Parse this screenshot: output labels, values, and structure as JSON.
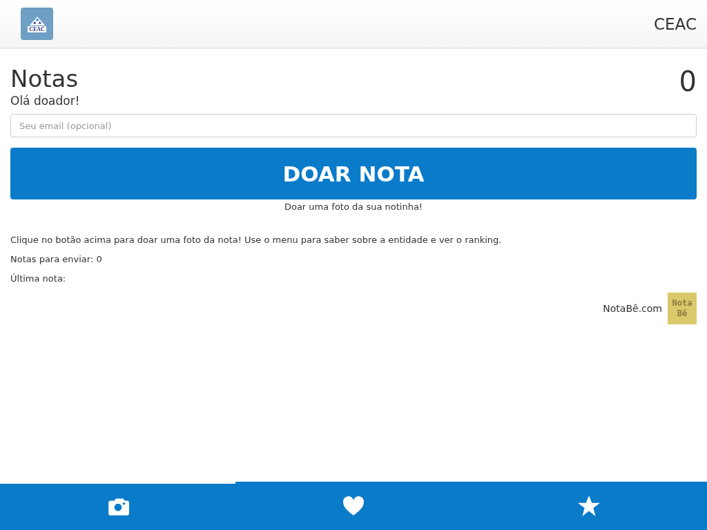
{
  "header": {
    "logo_text": "CEAC",
    "title": "CEAC"
  },
  "page": {
    "title": "Notas",
    "count": "0",
    "greeting": "Olá doador!"
  },
  "email_field": {
    "placeholder": "Seu email (opcional)"
  },
  "donate_button": {
    "label": "DOAR NOTA",
    "caption": "Doar uma foto da sua notinha!"
  },
  "info": [
    "Clique no botão acima para doar uma foto da nota! Use o menu para saber sobre a entidade e ver o ranking.",
    "Notas para enviar: 0",
    "Última nota:"
  ],
  "credit": {
    "text": "NotaBê.com",
    "logo_lines": [
      "Nota",
      "Bê"
    ]
  },
  "tab_bar": [
    {
      "kind": "camera",
      "selected": true
    },
    {
      "kind": "heart",
      "selected": false
    },
    {
      "kind": "star",
      "selected": false
    }
  ]
}
